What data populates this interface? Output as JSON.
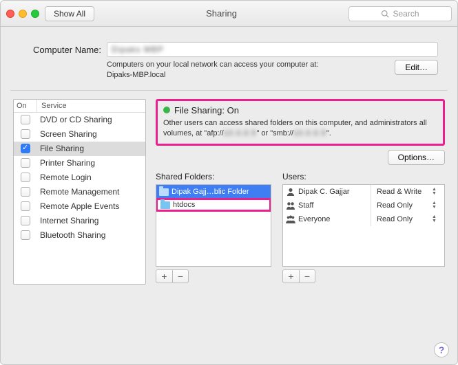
{
  "titlebar": {
    "show_all": "Show All",
    "title": "Sharing",
    "search_placeholder": "Search"
  },
  "computer": {
    "label": "Computer Name:",
    "value": "Dipaks MBP",
    "hint_line1": "Computers on your local network can access your computer at:",
    "hint_line2": "Dipaks-MBP.local",
    "edit": "Edit…"
  },
  "services": {
    "header_on": "On",
    "header_service": "Service",
    "items": [
      {
        "label": "DVD or CD Sharing",
        "checked": false
      },
      {
        "label": "Screen Sharing",
        "checked": false
      },
      {
        "label": "File Sharing",
        "checked": true
      },
      {
        "label": "Printer Sharing",
        "checked": false
      },
      {
        "label": "Remote Login",
        "checked": false
      },
      {
        "label": "Remote Management",
        "checked": false
      },
      {
        "label": "Remote Apple Events",
        "checked": false
      },
      {
        "label": "Internet Sharing",
        "checked": false
      },
      {
        "label": "Bluetooth Sharing",
        "checked": false
      }
    ]
  },
  "status": {
    "title": "File Sharing: On",
    "desc_pre": "Other users can access shared folders on this computer, and administrators all volumes, at \"afp://",
    "desc_mid": "\" or \"smb://",
    "desc_post": "\".",
    "hidden": "10.0.0.5"
  },
  "options_btn": "Options…",
  "shared": {
    "label": "Shared Folders:",
    "items": [
      {
        "label": "Dipak Gajj…blic Folder"
      },
      {
        "label": "htdocs"
      }
    ]
  },
  "users": {
    "label": "Users:",
    "items": [
      {
        "name": "Dipak C. Gajjar",
        "perm": "Read & Write",
        "icon": "single"
      },
      {
        "name": "Staff",
        "perm": "Read Only",
        "icon": "pair"
      },
      {
        "name": "Everyone",
        "perm": "Read Only",
        "icon": "group"
      }
    ]
  },
  "glyph": {
    "plus": "+",
    "minus": "−",
    "help": "?"
  }
}
